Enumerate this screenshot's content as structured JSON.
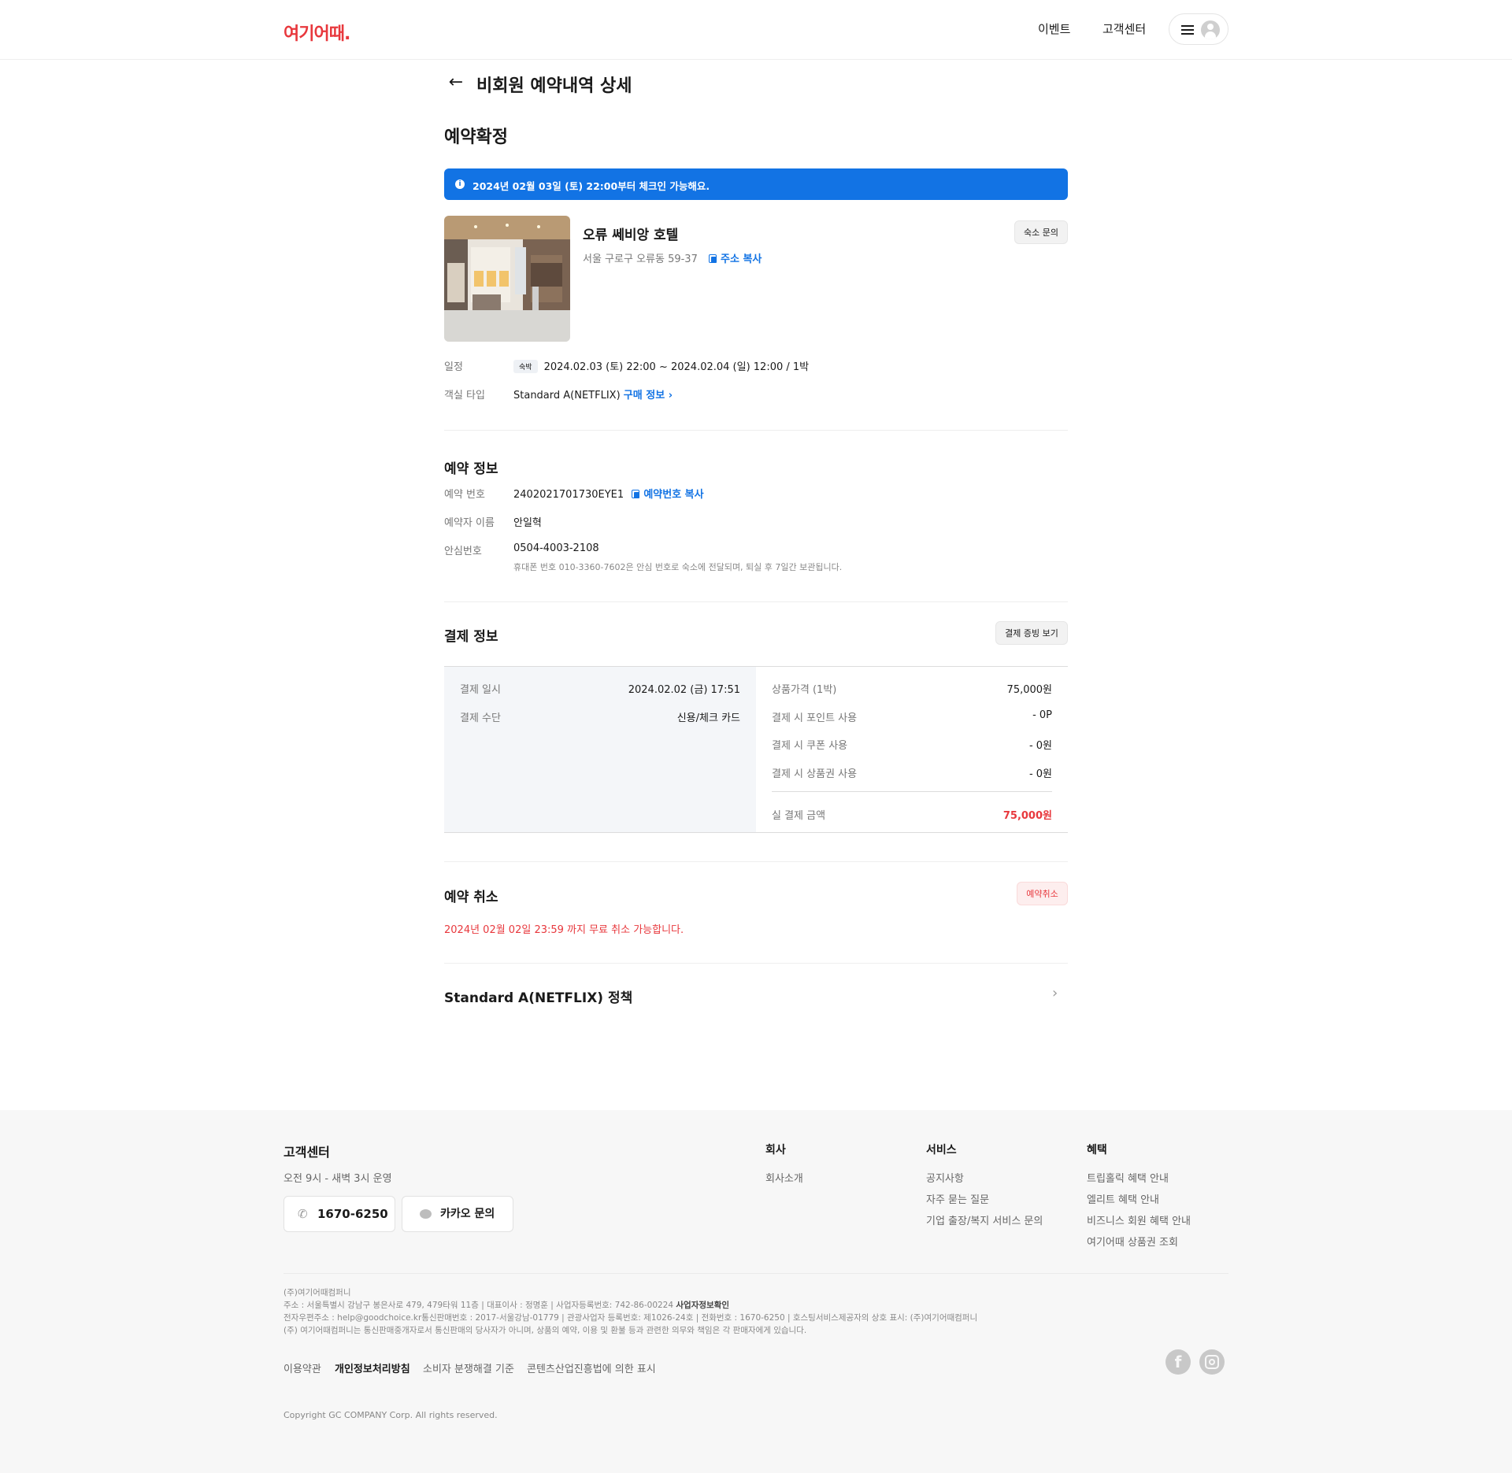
{
  "header": {
    "logo_text": "여기어때.",
    "nav": [
      "이벤트",
      "고객센터"
    ],
    "brand_color": "#e8383d"
  },
  "page": {
    "title": "비회원 예약내역 상세",
    "status": "예약확정",
    "notice": "2024년 02월 03일 (토) 22:00부터 체크인 가능해요.",
    "accent_color": "#1273e4"
  },
  "hotel": {
    "name": "오류 쎄비앙 호텔",
    "address": "서울 구로구 오류동 59-37",
    "copy_address_label": "주소 복사",
    "inquiry_label": "숙소 문의",
    "schedule_label": "일정",
    "stay_tag": "숙박",
    "schedule": "2024.02.03 (토) 22:00 ~ 2024.02.04 (일) 12:00 / 1박",
    "room_type_label": "객실 타입",
    "room_type": "Standard A(NETFLIX)",
    "purchase_info_label": "구매 정보"
  },
  "reservation": {
    "title": "예약 정보",
    "number_label": "예약 번호",
    "number": "2402021701730EYE1",
    "copy_number_label": "예약번호 복사",
    "name_label": "예약자 이름",
    "name": "안일혁",
    "safe_number_label": "안심번호",
    "safe_number": "0504-4003-2108",
    "safe_number_note": "휴대폰 번호 010-3360-7602은 안심 번호로 숙소에 전달되며, 퇴실 후 7일간 보관됩니다."
  },
  "payment": {
    "title": "결제 정보",
    "receipt_label": "결제 증빙 보기",
    "left": [
      {
        "label": "결제 일시",
        "value": "2024.02.02 (금) 17:51"
      },
      {
        "label": "결제 수단",
        "value": "신용/체크 카드"
      }
    ],
    "right": [
      {
        "label": "상품가격 (1박)",
        "value": "75,000원"
      },
      {
        "label": "결제 시 포인트 사용",
        "value": "- 0P"
      },
      {
        "label": "결제 시 쿠폰 사용",
        "value": "- 0원"
      },
      {
        "label": "결제 시 상품권 사용",
        "value": "- 0원"
      }
    ],
    "total_label": "실 결제 금액",
    "total": "75,000원"
  },
  "cancel": {
    "title": "예약 취소",
    "button": "예약취소",
    "note": "2024년 02월 02일 23:59 까지 무료 취소 가능합니다."
  },
  "policy": {
    "title": "Standard A(NETFLIX) 정책"
  },
  "footer": {
    "cs_title": "고객센터",
    "hours": "오전 9시 - 새벽 3시 운영",
    "phone": "1670-6250",
    "kakao": "카카오 문의",
    "columns": [
      {
        "title": "회사",
        "items": [
          "회사소개"
        ]
      },
      {
        "title": "서비스",
        "items": [
          "공지사항",
          "자주 묻는 질문",
          "기업 출장/복지 서비스 문의"
        ]
      },
      {
        "title": "혜택",
        "items": [
          "트립홀릭 혜택 안내",
          "엘리트 혜택 안내",
          "비즈니스 회원 혜택 안내",
          "여기어때 상품권 조회"
        ]
      }
    ],
    "company": "(주)여기어때컴퍼니",
    "address_line": "주소 : 서울특별시 강남구 봉은사로 479, 479타워 11층 | 대표이사 : 정명훈 | 사업자등록번호: 742-86-00224",
    "biz_info_link": "사업자정보확인",
    "contact_line": "전자우편주소 : help@goodchoice.kr통신판매번호 : 2017-서울강남-01779 | 관광사업자 등록번호: 제1026-24호 | 전화번호 : 1670-6250 | 호스팅서비스제공자의 상호 표시: (주)여기어때컴퍼니",
    "disclaimer": "(주) 여기어때컴퍼니는 통신판매중개자로서 통신판매의 당사자가 아니며, 상품의 예약, 이용 및 환불 등과 관련한 의무와 책임은 각 판매자에게 있습니다.",
    "links": [
      "이용약관",
      "개인정보처리방침",
      "소비자 분쟁해결 기준",
      "콘텐츠산업진흥법에 의한 표시"
    ],
    "social": [
      "facebook-icon",
      "instagram-icon"
    ],
    "copyright": "Copyright GC COMPANY Corp. All rights reserved."
  }
}
